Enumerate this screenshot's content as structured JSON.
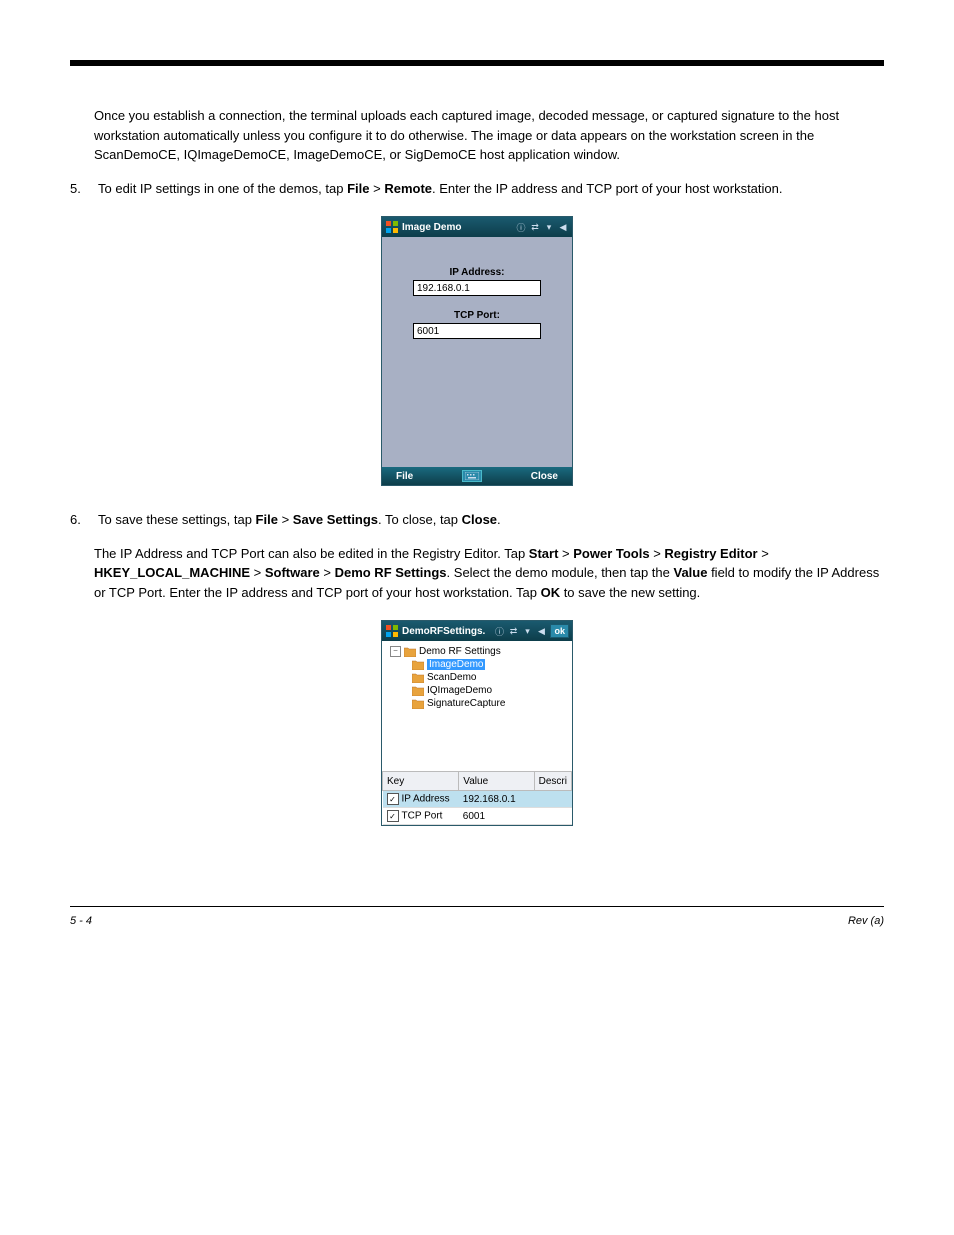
{
  "paragraph1": "Once you establish a connection, the terminal uploads each captured image, decoded message, or captured signature to the host workstation automatically unless you configure it to do otherwise. The image or data appears on the workstation screen in the ScanDemoCE, IQImageDemoCE, ImageDemoCE, or SigDemoCE host application window.",
  "step5_num": "5.",
  "step5_text_a": "To edit IP settings in one of the demos, tap ",
  "step5_file": "File",
  "step5_text_b": " > ",
  "step5_remote": "Remote",
  "step5_text_c": ". Enter the IP address and TCP port of your host workstation.",
  "win1": {
    "title": "Image Demo",
    "ip_label": "IP Address:",
    "ip_value": "192.168.0.1",
    "port_label": "TCP Port:",
    "port_value": "6001",
    "file_btn": "File",
    "close_btn": "Close"
  },
  "step6_num": "6.",
  "step6_text_a": "To save these settings, tap ",
  "step6_file": "File",
  "step6_text_b": " > ",
  "step6_save": "Save Settings",
  "step6_text_c": ". To close, tap ",
  "step6_close": "Close",
  "step6_text_d": ".",
  "editor_para_a": "The IP Address and TCP Port can also be edited in the Registry Editor. Tap ",
  "editor_start": "Start",
  "editor_b": " > ",
  "editor_powertools": "Power Tools",
  "editor_c": " > ",
  "editor_registry": "Registry Editor",
  "editor_d": " > ",
  "editor_hklm": "HKEY_LOCAL_MACHINE",
  "editor_e": " > ",
  "editor_software": "Software",
  "editor_f": " > ",
  "editor_demorf": "Demo RF Settings",
  "editor_g": ".  Select the demo module, then tap the ",
  "editor_value": "Value",
  "editor_h": " field to modify the IP Address or TCP Port. Enter the IP address and TCP port of your host workstation. Tap ",
  "editor_ok": "OK",
  "editor_i": " to save the new setting.",
  "win2": {
    "title": "DemoRFSettings.",
    "ok": "ok",
    "tree_root": "Demo RF Settings",
    "tree_items": [
      "ImageDemo",
      "ScanDemo",
      "IQImageDemo",
      "SignatureCapture"
    ],
    "col_key": "Key",
    "col_value": "Value",
    "col_desc": "Descri",
    "rows": [
      {
        "key": "IP Address",
        "value": "192.168.0.1"
      },
      {
        "key": "TCP Port",
        "value": "6001"
      }
    ]
  },
  "footer_left": "5 - 4",
  "footer_right": "Rev (a)"
}
